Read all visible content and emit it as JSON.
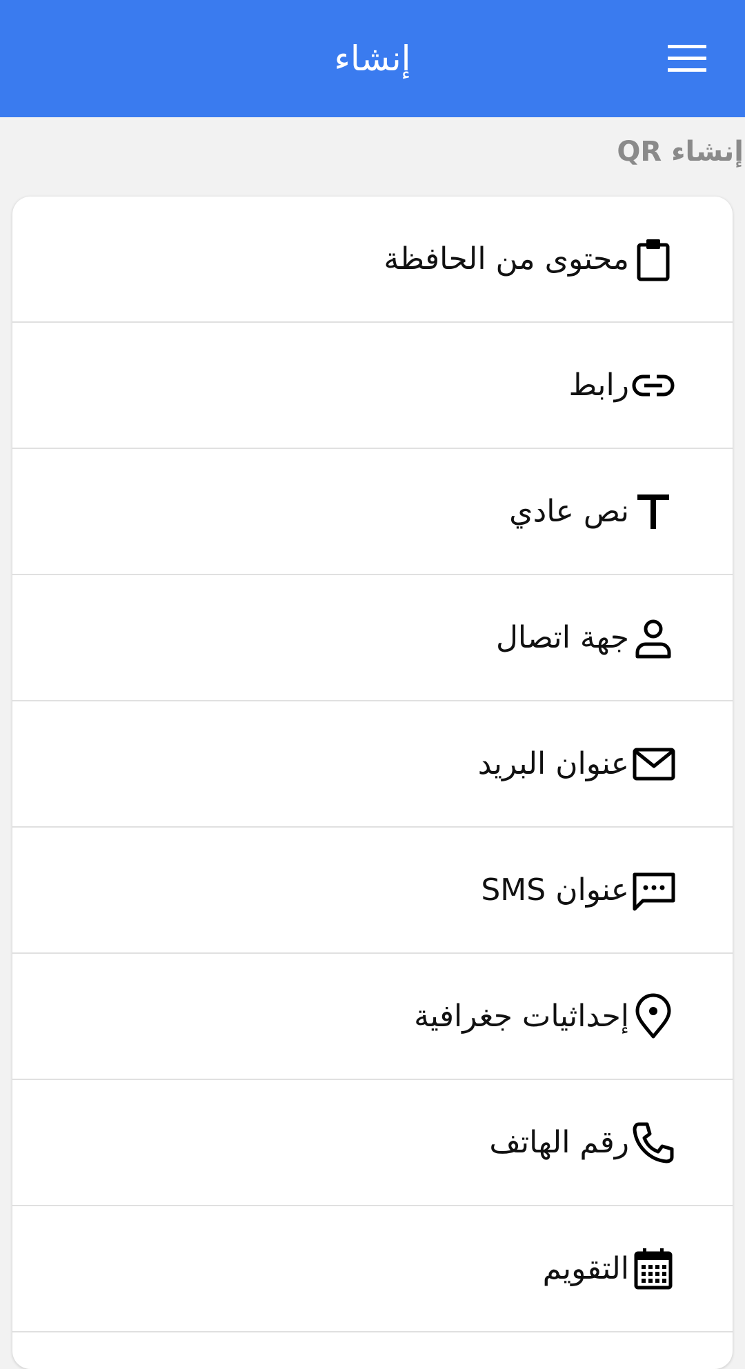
{
  "header": {
    "title": "إنشاء"
  },
  "section": {
    "label": "إنشاء QR"
  },
  "items": [
    {
      "label": "محتوى من الحافظة",
      "icon": "clipboard-icon"
    },
    {
      "label": "رابط",
      "icon": "link-icon"
    },
    {
      "label": "نص عادي",
      "icon": "text-icon"
    },
    {
      "label": "جهة اتصال",
      "icon": "contact-person-icon"
    },
    {
      "label": "عنوان البريد",
      "icon": "mail-icon"
    },
    {
      "label": "عنوان SMS",
      "icon": "sms-icon"
    },
    {
      "label": "إحداثيات جغرافية",
      "icon": "location-pin-icon"
    },
    {
      "label": "رقم الهاتف",
      "icon": "phone-icon"
    },
    {
      "label": "التقويم",
      "icon": "calendar-icon"
    }
  ],
  "colors": {
    "appbar": "#3a7bef",
    "background": "#f2f2f2",
    "section_label": "#8a8a8a",
    "item_text": "#111111"
  }
}
